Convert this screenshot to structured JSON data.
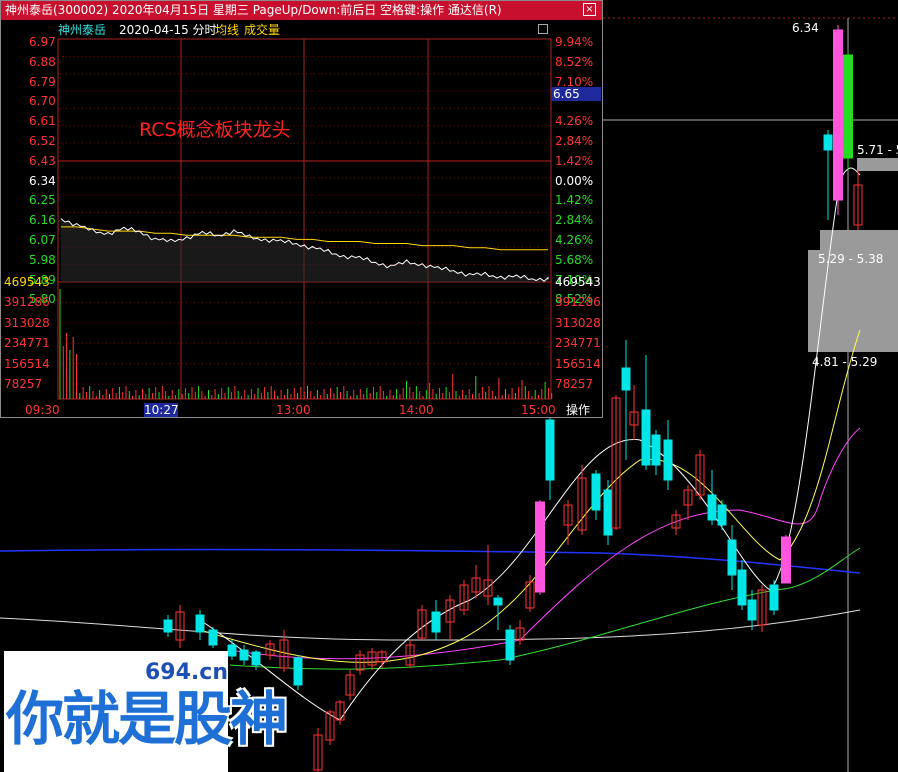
{
  "window": {
    "title": "神州泰岳(300002) 2020年04月15日 星期三 PageUp/Down:前后日 空格键:操作 通达信(R)",
    "close_glyph": "×"
  },
  "info_bar": {
    "stock_name": "神州泰岳",
    "date_label": "2020-04-15 分时",
    "avg_label": "均线",
    "vol_label": "成交量"
  },
  "annotation": "RCS概念板块龙头",
  "price_axis_left": [
    {
      "text": "6.97",
      "color": "red"
    },
    {
      "text": "6.88",
      "color": "red"
    },
    {
      "text": "6.79",
      "color": "red"
    },
    {
      "text": "6.70",
      "color": "red"
    },
    {
      "text": "6.61",
      "color": "red"
    },
    {
      "text": "6.52",
      "color": "red"
    },
    {
      "text": "6.43",
      "color": "red"
    },
    {
      "text": "6.34",
      "color": "white"
    },
    {
      "text": "6.25",
      "color": "green"
    },
    {
      "text": "6.16",
      "color": "green"
    },
    {
      "text": "6.07",
      "color": "green"
    },
    {
      "text": "5.98",
      "color": "green"
    },
    {
      "text": "5.89",
      "color": "green"
    },
    {
      "text": "5.80",
      "color": "green"
    }
  ],
  "pct_axis_right": [
    {
      "text": "9.94%",
      "color": "red"
    },
    {
      "text": "8.52%",
      "color": "red"
    },
    {
      "text": "7.10%",
      "color": "red"
    },
    {
      "text": "6.65",
      "color": "white"
    },
    {
      "text": "4.26%",
      "color": "red"
    },
    {
      "text": "2.84%",
      "color": "red"
    },
    {
      "text": "1.42%",
      "color": "red"
    },
    {
      "text": "0.00%",
      "color": "white"
    },
    {
      "text": "1.42%",
      "color": "green"
    },
    {
      "text": "2.84%",
      "color": "green"
    },
    {
      "text": "4.26%",
      "color": "green"
    },
    {
      "text": "5.68%",
      "color": "green"
    },
    {
      "text": "7.10%",
      "color": "green"
    },
    {
      "text": "8.52%",
      "color": "green"
    }
  ],
  "current_price_tag": "6.65",
  "volume_axis_left": [
    "469543",
    "391286",
    "313028",
    "234771",
    "156514",
    "78257"
  ],
  "volume_axis_right": [
    "469543",
    "391286",
    "313028",
    "234771",
    "156514",
    "78257"
  ],
  "time_axis": [
    "09:30",
    "13:00",
    "14:00",
    "15:00"
  ],
  "time_cursor": "10:27",
  "op_button": "操作",
  "kline_labels": {
    "top_price": "6.34",
    "range_upper": "5.71 - 5",
    "range_mid": "5.29 - 5.38",
    "range_low": "4.81 - 5.29"
  },
  "watermark": {
    "site": "694.cn",
    "text": "你就是股神"
  },
  "colors": {
    "up": "#ff3333",
    "down_solid": "#00e5e5",
    "limit_up": "#ff55dd",
    "ma_white": "#ffffff",
    "ma_yellow": "#ffff55",
    "ma_magenta": "#ff44ff",
    "ma_green": "#33dd33",
    "ma_blue": "#2233ff",
    "avg_line": "#ffd700"
  },
  "chart_data": [
    {
      "type": "line",
      "title": "神州泰岳 2020-04-15 分时",
      "y_range": [
        5.8,
        6.97
      ],
      "prev_close": 6.34,
      "series": [
        {
          "name": "price",
          "values": [
            6.11,
            6.08,
            6.05,
            6.04,
            6.06,
            6.05,
            6.01,
            6.0,
            6.02,
            6.04,
            6.03,
            6.05,
            6.02,
            6.01,
            6.0,
            5.99,
            5.97,
            5.95,
            5.93,
            5.92,
            5.9,
            5.88,
            5.9,
            5.89,
            5.87,
            5.86,
            5.84,
            5.84,
            5.83,
            5.83,
            5.82,
            5.82
          ]
        },
        {
          "name": "均线",
          "values": [
            6.07,
            6.07,
            6.06,
            6.05,
            6.05,
            6.05,
            6.04,
            6.04,
            6.03,
            6.03,
            6.03,
            6.03,
            6.02,
            6.02,
            6.02,
            6.01,
            6.01,
            6.0,
            6.0,
            6.0,
            5.99,
            5.99,
            5.99,
            5.98,
            5.98,
            5.98,
            5.97,
            5.97,
            5.96,
            5.96,
            5.96,
            5.96
          ]
        }
      ],
      "volume_max": 469543
    }
  ]
}
